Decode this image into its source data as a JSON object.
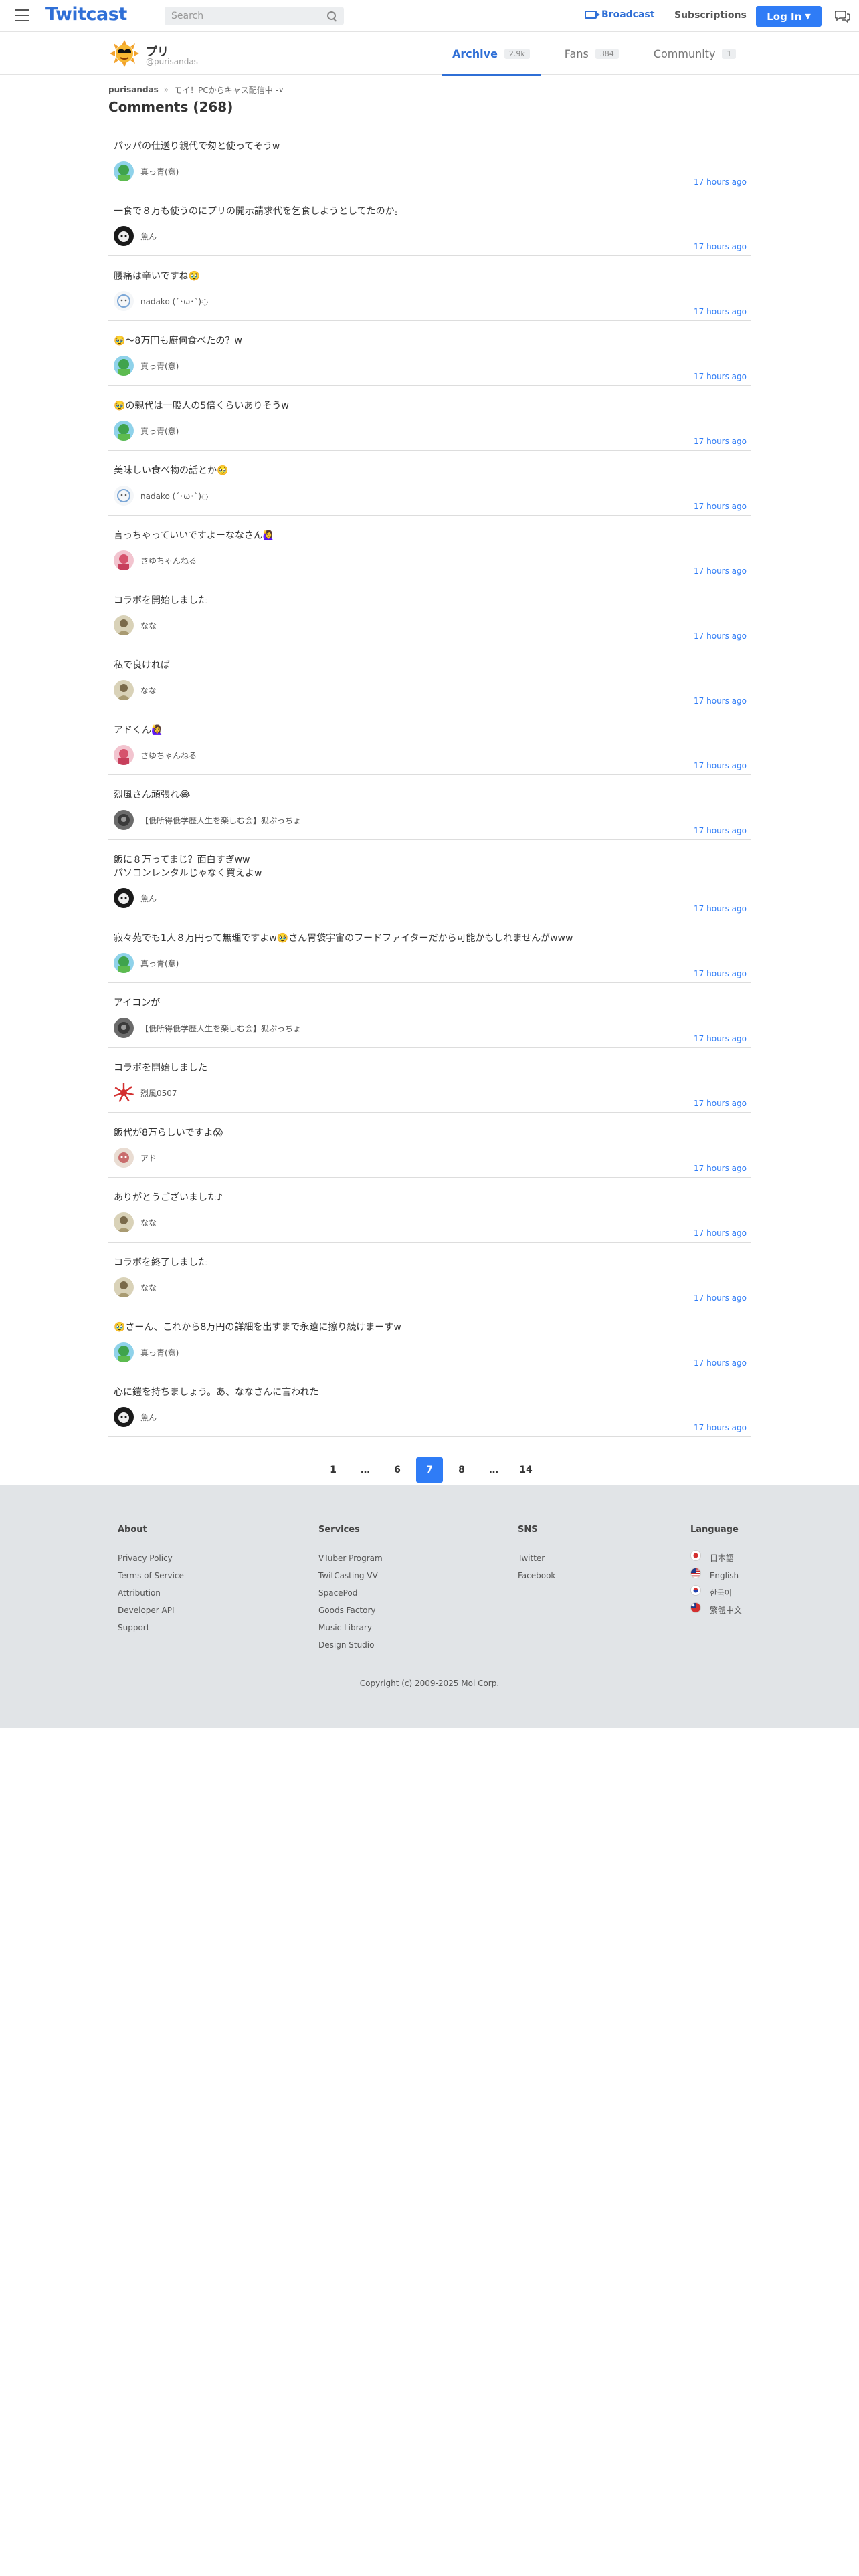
{
  "header": {
    "logo": "Twitcast",
    "search_placeholder": "Search",
    "broadcast": "Broadcast",
    "subscriptions": "Subscriptions",
    "login": "Log In"
  },
  "profile": {
    "name": "プリ",
    "handle": "@purisandas",
    "tabs": [
      {
        "label": "Archive",
        "count": "2.9k"
      },
      {
        "label": "Fans",
        "count": "384"
      },
      {
        "label": "Community",
        "count": "1"
      }
    ]
  },
  "breadcrumb": {
    "home": "purisandas",
    "sep": "»",
    "current": "モイ！PCからキャス配信中 - ",
    "chev": "∨"
  },
  "page_title": "Comments (268)",
  "comments": [
    {
      "text": "パッパの仕送り親代で匆と使ってそうw",
      "user": "真っ青(意)",
      "time": "17 hours ago",
      "avatar": "green"
    },
    {
      "text": "一食で８万も使うのにプリの開示請求代を乞食しようとしてたのか。",
      "user": "魚ん",
      "time": "17 hours ago",
      "avatar": "dark"
    },
    {
      "text": "腰痛は辛いですね🥹",
      "user": "nadako (´･ω･`)◌",
      "time": "17 hours ago",
      "avatar": "nadako"
    },
    {
      "text": "🥹〜8万円も廚何食べたの？w",
      "user": "真っ青(意)",
      "time": "17 hours ago",
      "avatar": "green"
    },
    {
      "text": "🥹の親代は一般人の5倍くらいありそうw",
      "user": "真っ青(意)",
      "time": "17 hours ago",
      "avatar": "green"
    },
    {
      "text": "美味しい食べ物の話とか🥹",
      "user": "nadako (´･ω･`)◌",
      "time": "17 hours ago",
      "avatar": "nadako"
    },
    {
      "text": "言っちゃっていいですよーななさん🙋‍♀️",
      "user": "さゆちゃんねる",
      "time": "17 hours ago",
      "avatar": "pink"
    },
    {
      "text": "コラボを開始しました",
      "user": "なな",
      "time": "17 hours ago",
      "avatar": "nana"
    },
    {
      "text": "私で良ければ",
      "user": "なな",
      "time": "17 hours ago",
      "avatar": "nana"
    },
    {
      "text": "アドくん🙋‍♀️",
      "user": "さゆちゃんねる",
      "time": "17 hours ago",
      "avatar": "pink"
    },
    {
      "text": "烈風さん頑張れ😂",
      "user": "【低所得低学歴人生を楽しむ会】狐ぷっちょ",
      "time": "17 hours ago",
      "avatar": "fox"
    },
    {
      "text": "飯に８万ってまじ？面白すぎww\nパソコンレンタルじゃなく買えよw",
      "user": "魚ん",
      "time": "17 hours ago",
      "avatar": "dark"
    },
    {
      "text": "寂々苑でも1人８万円って無理ですよw🥹さん胃袋宇宙のフードファイターだから可能かもしれませんがwww",
      "user": "真っ青(意)",
      "time": "17 hours ago",
      "avatar": "green"
    },
    {
      "text": "アイコンが",
      "user": "【低所得低学歴人生を楽しむ会】狐ぷっちょ",
      "time": "17 hours ago",
      "avatar": "fox"
    },
    {
      "text": "コラボを開始しました",
      "user": "烈風0507",
      "time": "17 hours ago",
      "avatar": "sun"
    },
    {
      "text": "飯代が8万らしいですよ😱",
      "user": "アド",
      "time": "17 hours ago",
      "avatar": "ado"
    },
    {
      "text": "ありがとうございました♪",
      "user": "なな",
      "time": "17 hours ago",
      "avatar": "nana"
    },
    {
      "text": "コラボを終了しました",
      "user": "なな",
      "time": "17 hours ago",
      "avatar": "nana"
    },
    {
      "text": "🥹さーん、これから8万円の詳細を出すまで永遠に擦り続けまーすw",
      "user": "真っ青(意)",
      "time": "17 hours ago",
      "avatar": "green"
    },
    {
      "text": "心に鎧を持ちましょう。あ、ななさんに言われた",
      "user": "魚ん",
      "time": "17 hours ago",
      "avatar": "dark"
    }
  ],
  "pagination": {
    "pages": [
      {
        "label": "1",
        "active": false
      },
      {
        "label": "…",
        "active": false
      },
      {
        "label": "6",
        "active": false
      },
      {
        "label": "7",
        "active": true
      },
      {
        "label": "8",
        "active": false
      },
      {
        "label": "…",
        "active": false
      },
      {
        "label": "14",
        "active": false
      }
    ]
  },
  "footer": {
    "about": {
      "title": "About",
      "links": [
        "Privacy Policy",
        "Terms of Service",
        "Attribution",
        "Developer API",
        "Support"
      ]
    },
    "services": {
      "title": "Services",
      "links": [
        "VTuber Program",
        "TwitCasting VV",
        "SpacePod",
        "Goods Factory",
        "Music Library",
        "Design Studio"
      ]
    },
    "sns": {
      "title": "SNS",
      "links": [
        "Twitter",
        "Facebook"
      ]
    },
    "language": {
      "title": "Language",
      "links": [
        "日本語",
        "English",
        "한국어",
        "繁體中文"
      ]
    },
    "copyright": "Copyright (c) 2009-2025 Moi Corp."
  }
}
